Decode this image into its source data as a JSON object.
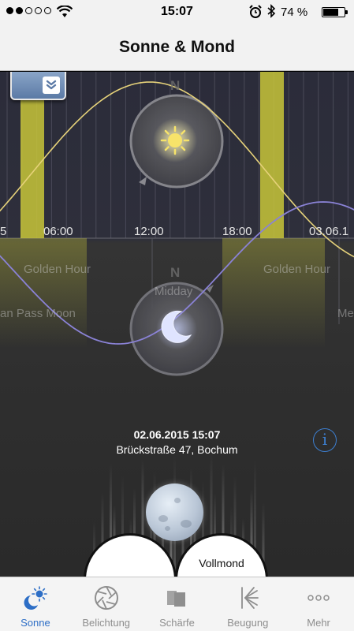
{
  "status_bar": {
    "time": "15:07",
    "battery_text": "74 %",
    "signal_bars_filled": 2,
    "signal_bars_total": 5
  },
  "nav": {
    "title": "Sonne & Mond"
  },
  "timeline": {
    "ticks": [
      "5",
      "06:00",
      "12:00",
      "18:00",
      "03.06.1"
    ],
    "north_label": "N",
    "golden_hour_label_1": "Golden Hour",
    "golden_hour_label_2": "Golden Hour",
    "midday_label": "Midday",
    "moon_pass_label": "an Pass Moon",
    "moon_right_label": "Me"
  },
  "info": {
    "datetime": "02.06.2015 15:07",
    "address": "Brückstraße 47, Bochum",
    "info_icon": "i"
  },
  "moon_phase": {
    "label": "Vollmond"
  },
  "tabs": [
    {
      "label": "Sonne",
      "icon": "sun-moon-icon",
      "active": true
    },
    {
      "label": "Belichtung",
      "icon": "aperture-icon",
      "active": false
    },
    {
      "label": "Schärfe",
      "icon": "focus-icon",
      "active": false
    },
    {
      "label": "Beugung",
      "icon": "diffraction-icon",
      "active": false
    },
    {
      "label": "Mehr",
      "icon": "more-icon",
      "active": false
    }
  ],
  "colors": {
    "sun_curve": "#e6d27a",
    "moon_curve": "#8a82d6",
    "golden_band": "#c8c63a",
    "tab_active": "#2d6ec6",
    "tab_inactive": "#8e8e8e"
  }
}
